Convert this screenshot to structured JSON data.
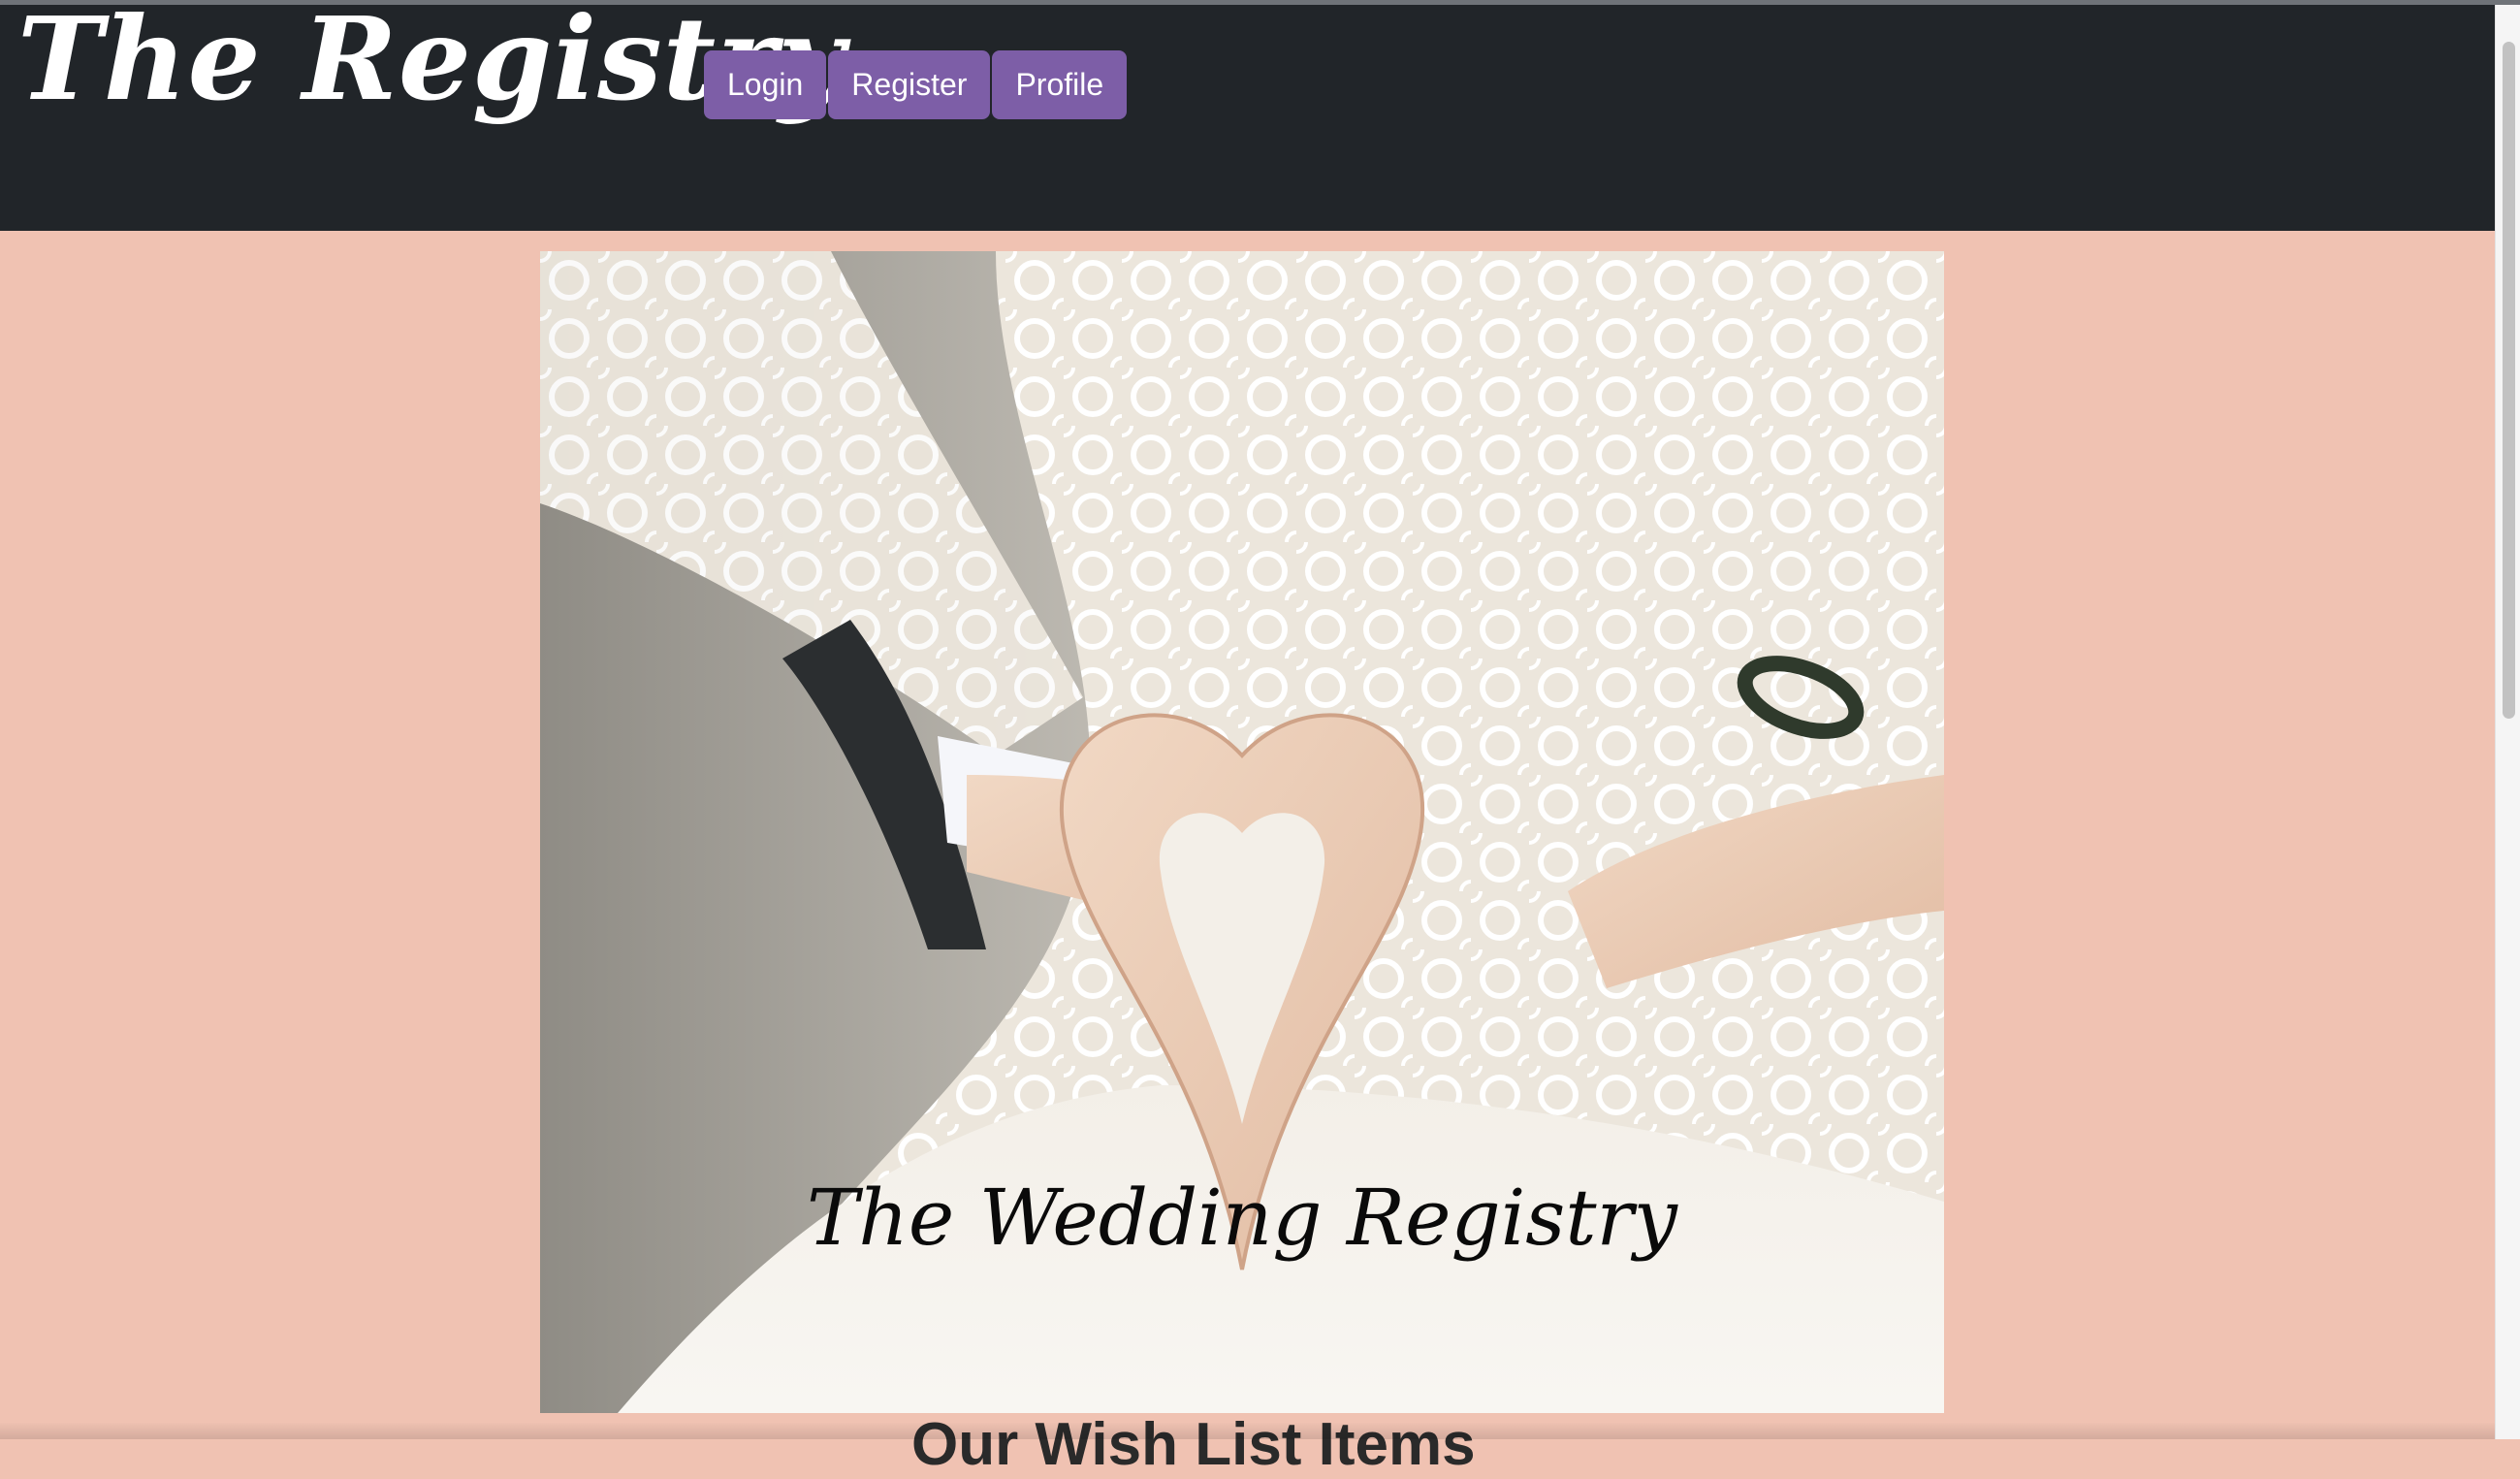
{
  "navbar": {
    "brand": "The Registry",
    "buttons": [
      {
        "label": "Login"
      },
      {
        "label": "Register"
      },
      {
        "label": "Profile"
      }
    ]
  },
  "hero": {
    "caption": "The Wedding Registry"
  },
  "section": {
    "heading": "Our Wish List Items"
  },
  "colors": {
    "navbar_bg": "#212529",
    "button_bg": "#7d5ea7",
    "page_bg": "#f0c2b2"
  }
}
